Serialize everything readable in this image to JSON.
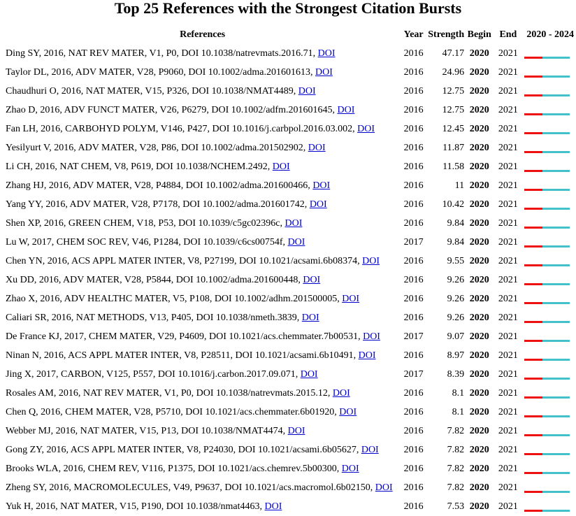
{
  "title": "Top 25 References with the Strongest Citation Bursts",
  "headers": {
    "references": "References",
    "year": "Year",
    "strength": "Strength",
    "begin": "Begin",
    "end": "End",
    "range": "2020 - 2024"
  },
  "doi_label": "DOI",
  "timeline": {
    "start": 2020,
    "end": 2024
  },
  "colors": {
    "burst": "#ee1111",
    "normal": "#44c0c8",
    "link": "#0000cc"
  },
  "rows": [
    {
      "ref": "Ding SY, 2016, NAT REV MATER, V1, P0, DOI 10.1038/natrevmats.2016.71,",
      "year": "2016",
      "strength": "47.17",
      "begin": "2020",
      "end": "2021"
    },
    {
      "ref": "Taylor DL, 2016, ADV MATER, V28, P9060, DOI 10.1002/adma.201601613,",
      "year": "2016",
      "strength": "24.96",
      "begin": "2020",
      "end": "2021"
    },
    {
      "ref": "Chaudhuri O, 2016, NAT MATER, V15, P326, DOI 10.1038/NMAT4489,",
      "year": "2016",
      "strength": "12.75",
      "begin": "2020",
      "end": "2021"
    },
    {
      "ref": "Zhao D, 2016, ADV FUNCT MATER, V26, P6279, DOI 10.1002/adfm.201601645,",
      "year": "2016",
      "strength": "12.75",
      "begin": "2020",
      "end": "2021"
    },
    {
      "ref": "Fan LH, 2016, CARBOHYD POLYM, V146, P427, DOI 10.1016/j.carbpol.2016.03.002,",
      "year": "2016",
      "strength": "12.45",
      "begin": "2020",
      "end": "2021"
    },
    {
      "ref": "Yesilyurt V, 2016, ADV MATER, V28, P86, DOI 10.1002/adma.201502902,",
      "year": "2016",
      "strength": "11.87",
      "begin": "2020",
      "end": "2021"
    },
    {
      "ref": "Li CH, 2016, NAT CHEM, V8, P619, DOI 10.1038/NCHEM.2492,",
      "year": "2016",
      "strength": "11.58",
      "begin": "2020",
      "end": "2021"
    },
    {
      "ref": "Zhang HJ, 2016, ADV MATER, V28, P4884, DOI 10.1002/adma.201600466,",
      "year": "2016",
      "strength": "11",
      "begin": "2020",
      "end": "2021"
    },
    {
      "ref": "Yang YY, 2016, ADV MATER, V28, P7178, DOI 10.1002/adma.201601742,",
      "year": "2016",
      "strength": "10.42",
      "begin": "2020",
      "end": "2021"
    },
    {
      "ref": "Shen XP, 2016, GREEN CHEM, V18, P53, DOI 10.1039/c5gc02396c,",
      "year": "2016",
      "strength": "9.84",
      "begin": "2020",
      "end": "2021"
    },
    {
      "ref": "Lu W, 2017, CHEM SOC REV, V46, P1284, DOI 10.1039/c6cs00754f,",
      "year": "2017",
      "strength": "9.84",
      "begin": "2020",
      "end": "2021"
    },
    {
      "ref": "Chen YN, 2016, ACS APPL MATER INTER, V8, P27199, DOI 10.1021/acsami.6b08374,",
      "year": "2016",
      "strength": "9.55",
      "begin": "2020",
      "end": "2021"
    },
    {
      "ref": "Xu DD, 2016, ADV MATER, V28, P5844, DOI 10.1002/adma.201600448,",
      "year": "2016",
      "strength": "9.26",
      "begin": "2020",
      "end": "2021"
    },
    {
      "ref": "Zhao X, 2016, ADV HEALTHC MATER, V5, P108, DOI 10.1002/adhm.201500005,",
      "year": "2016",
      "strength": "9.26",
      "begin": "2020",
      "end": "2021"
    },
    {
      "ref": "Caliari SR, 2016, NAT METHODS, V13, P405, DOI 10.1038/nmeth.3839,",
      "year": "2016",
      "strength": "9.26",
      "begin": "2020",
      "end": "2021"
    },
    {
      "ref": "De France KJ, 2017, CHEM MATER, V29, P4609, DOI 10.1021/acs.chemmater.7b00531,",
      "year": "2017",
      "strength": "9.07",
      "begin": "2020",
      "end": "2021"
    },
    {
      "ref": "Ninan N, 2016, ACS APPL MATER INTER, V8, P28511, DOI 10.1021/acsami.6b10491,",
      "year": "2016",
      "strength": "8.97",
      "begin": "2020",
      "end": "2021"
    },
    {
      "ref": "Jing X, 2017, CARBON, V125, P557, DOI 10.1016/j.carbon.2017.09.071,",
      "year": "2017",
      "strength": "8.39",
      "begin": "2020",
      "end": "2021"
    },
    {
      "ref": "Rosales AM, 2016, NAT REV MATER, V1, P0, DOI 10.1038/natrevmats.2015.12,",
      "year": "2016",
      "strength": "8.1",
      "begin": "2020",
      "end": "2021"
    },
    {
      "ref": "Chen Q, 2016, CHEM MATER, V28, P5710, DOI 10.1021/acs.chemmater.6b01920,",
      "year": "2016",
      "strength": "8.1",
      "begin": "2020",
      "end": "2021"
    },
    {
      "ref": "Webber MJ, 2016, NAT MATER, V15, P13, DOI 10.1038/NMAT4474,",
      "year": "2016",
      "strength": "7.82",
      "begin": "2020",
      "end": "2021"
    },
    {
      "ref": "Gong ZY, 2016, ACS APPL MATER INTER, V8, P24030, DOI 10.1021/acsami.6b05627,",
      "year": "2016",
      "strength": "7.82",
      "begin": "2020",
      "end": "2021"
    },
    {
      "ref": "Brooks WLA, 2016, CHEM REV, V116, P1375, DOI 10.1021/acs.chemrev.5b00300,",
      "year": "2016",
      "strength": "7.82",
      "begin": "2020",
      "end": "2021"
    },
    {
      "ref": "Zheng SY, 2016, MACROMOLECULES, V49, P9637, DOI 10.1021/acs.macromol.6b02150,",
      "year": "2016",
      "strength": "7.82",
      "begin": "2020",
      "end": "2021"
    },
    {
      "ref": "Yuk H, 2016, NAT MATER, V15, P190, DOI 10.1038/nmat4463,",
      "year": "2016",
      "strength": "7.53",
      "begin": "2020",
      "end": "2021"
    }
  ]
}
